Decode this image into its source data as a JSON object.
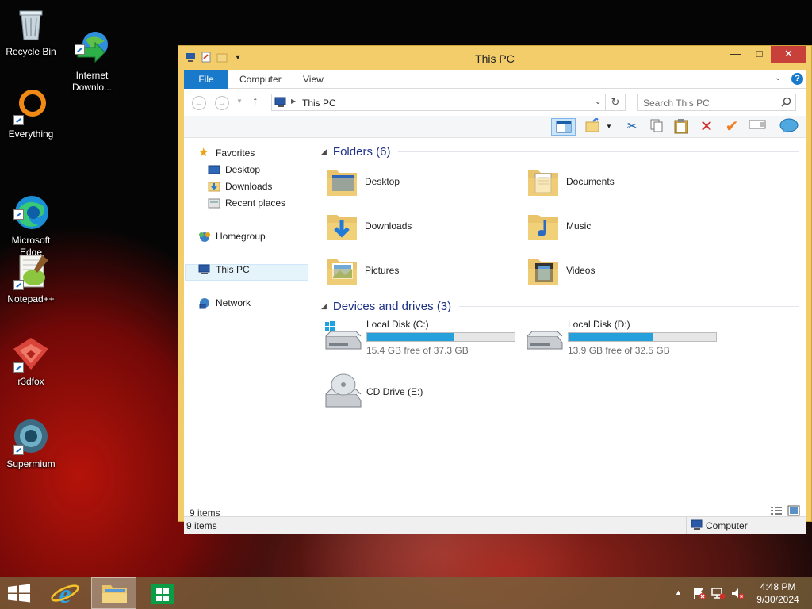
{
  "desktop": {
    "icons": [
      {
        "label": "Recycle Bin",
        "icon": "recycle-bin-icon"
      },
      {
        "label": "Internet\nDownlo...",
        "icon": "internet-download-manager-icon"
      },
      {
        "label": "Everything",
        "icon": "everything-search-icon"
      },
      {
        "label": "Microsoft\nEdge",
        "icon": "microsoft-edge-icon"
      },
      {
        "label": "Notepad++",
        "icon": "notepad-plus-plus-icon"
      },
      {
        "label": "r3dfox",
        "icon": "r3dfox-browser-icon"
      },
      {
        "label": "Supermium",
        "icon": "supermium-browser-icon"
      }
    ]
  },
  "window": {
    "title": "This PC",
    "controls": {
      "minimize": "—",
      "maximize": "□",
      "close": "✕"
    },
    "accent": "#f2cd6a"
  },
  "ribbon": {
    "tabs": [
      "File",
      "Computer",
      "View"
    ],
    "file_color": "#1979ca"
  },
  "address": {
    "path": "This PC",
    "search_placeholder": "Search This PC"
  },
  "nav_pane": {
    "favorites": "Favorites",
    "favorites_items": [
      "Desktop",
      "Downloads",
      "Recent places"
    ],
    "homegroup": "Homegroup",
    "this_pc": "This PC",
    "network": "Network"
  },
  "content": {
    "folders_header": "Folders (6)",
    "folders": [
      {
        "name": "Desktop",
        "icon": "desktop-folder-icon"
      },
      {
        "name": "Documents",
        "icon": "documents-folder-icon"
      },
      {
        "name": "Downloads",
        "icon": "downloads-folder-icon"
      },
      {
        "name": "Music",
        "icon": "music-folder-icon"
      },
      {
        "name": "Pictures",
        "icon": "pictures-folder-icon"
      },
      {
        "name": "Videos",
        "icon": "videos-folder-icon"
      }
    ],
    "drives_header": "Devices and drives (3)",
    "drives": [
      {
        "name": "Local Disk (C:)",
        "free": "15.4 GB free of 37.3 GB",
        "used_fraction": 0.587
      },
      {
        "name": "Local Disk (D:)",
        "free": "13.9 GB free of 32.5 GB",
        "used_fraction": 0.572
      },
      {
        "name": "CD Drive (E:)"
      }
    ],
    "bar_color": "#26a0da"
  },
  "status": {
    "inner_count": "9 items",
    "bar_count": "9 items",
    "location": "Computer"
  },
  "taskbar": {
    "time": "4:48 PM",
    "date": "9/30/2024"
  }
}
